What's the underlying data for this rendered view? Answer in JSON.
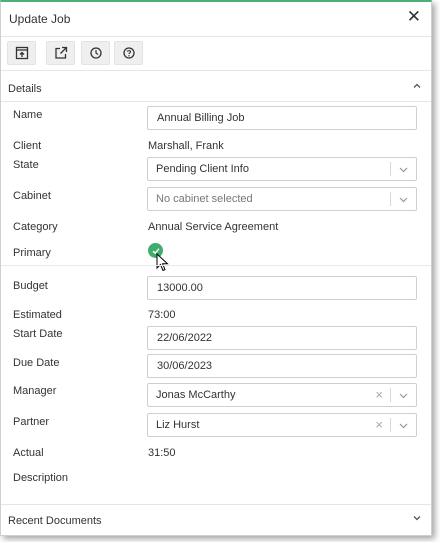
{
  "dialog": {
    "title": "Update Job",
    "close_label": "✕"
  },
  "toolbar": {
    "buttons": [
      {
        "icon": "open-in-panel-icon"
      },
      {
        "icon": "external-link-icon"
      },
      {
        "icon": "clock-icon"
      },
      {
        "icon": "help-icon"
      }
    ]
  },
  "details": {
    "header": "Details",
    "fields": {
      "name": {
        "label": "Name",
        "value": "Annual Billing Job"
      },
      "client": {
        "label": "Client",
        "value": "Marshall, Frank"
      },
      "state": {
        "label": "State",
        "value": "Pending Client Info"
      },
      "cabinet": {
        "label": "Cabinet",
        "placeholder": "No cabinet selected"
      },
      "category": {
        "label": "Category",
        "value": "Annual Service Agreement"
      },
      "primary": {
        "label": "Primary",
        "checked": true
      },
      "budget": {
        "label": "Budget",
        "value": "13000.00"
      },
      "estimated": {
        "label": "Estimated",
        "value": "73:00"
      },
      "start_date": {
        "label": "Start Date",
        "value": "22/06/2022"
      },
      "due_date": {
        "label": "Due Date",
        "value": "30/06/2023"
      },
      "manager": {
        "label": "Manager",
        "value": "Jonas McCarthy"
      },
      "partner": {
        "label": "Partner",
        "value": "Liz Hurst"
      },
      "actual": {
        "label": "Actual",
        "value": "31:50"
      },
      "description": {
        "label": "Description",
        "value": ""
      }
    }
  },
  "recent_documents": {
    "header": "Recent Documents"
  },
  "colors": {
    "accent": "#4caf78",
    "check": "#3fae6d"
  }
}
